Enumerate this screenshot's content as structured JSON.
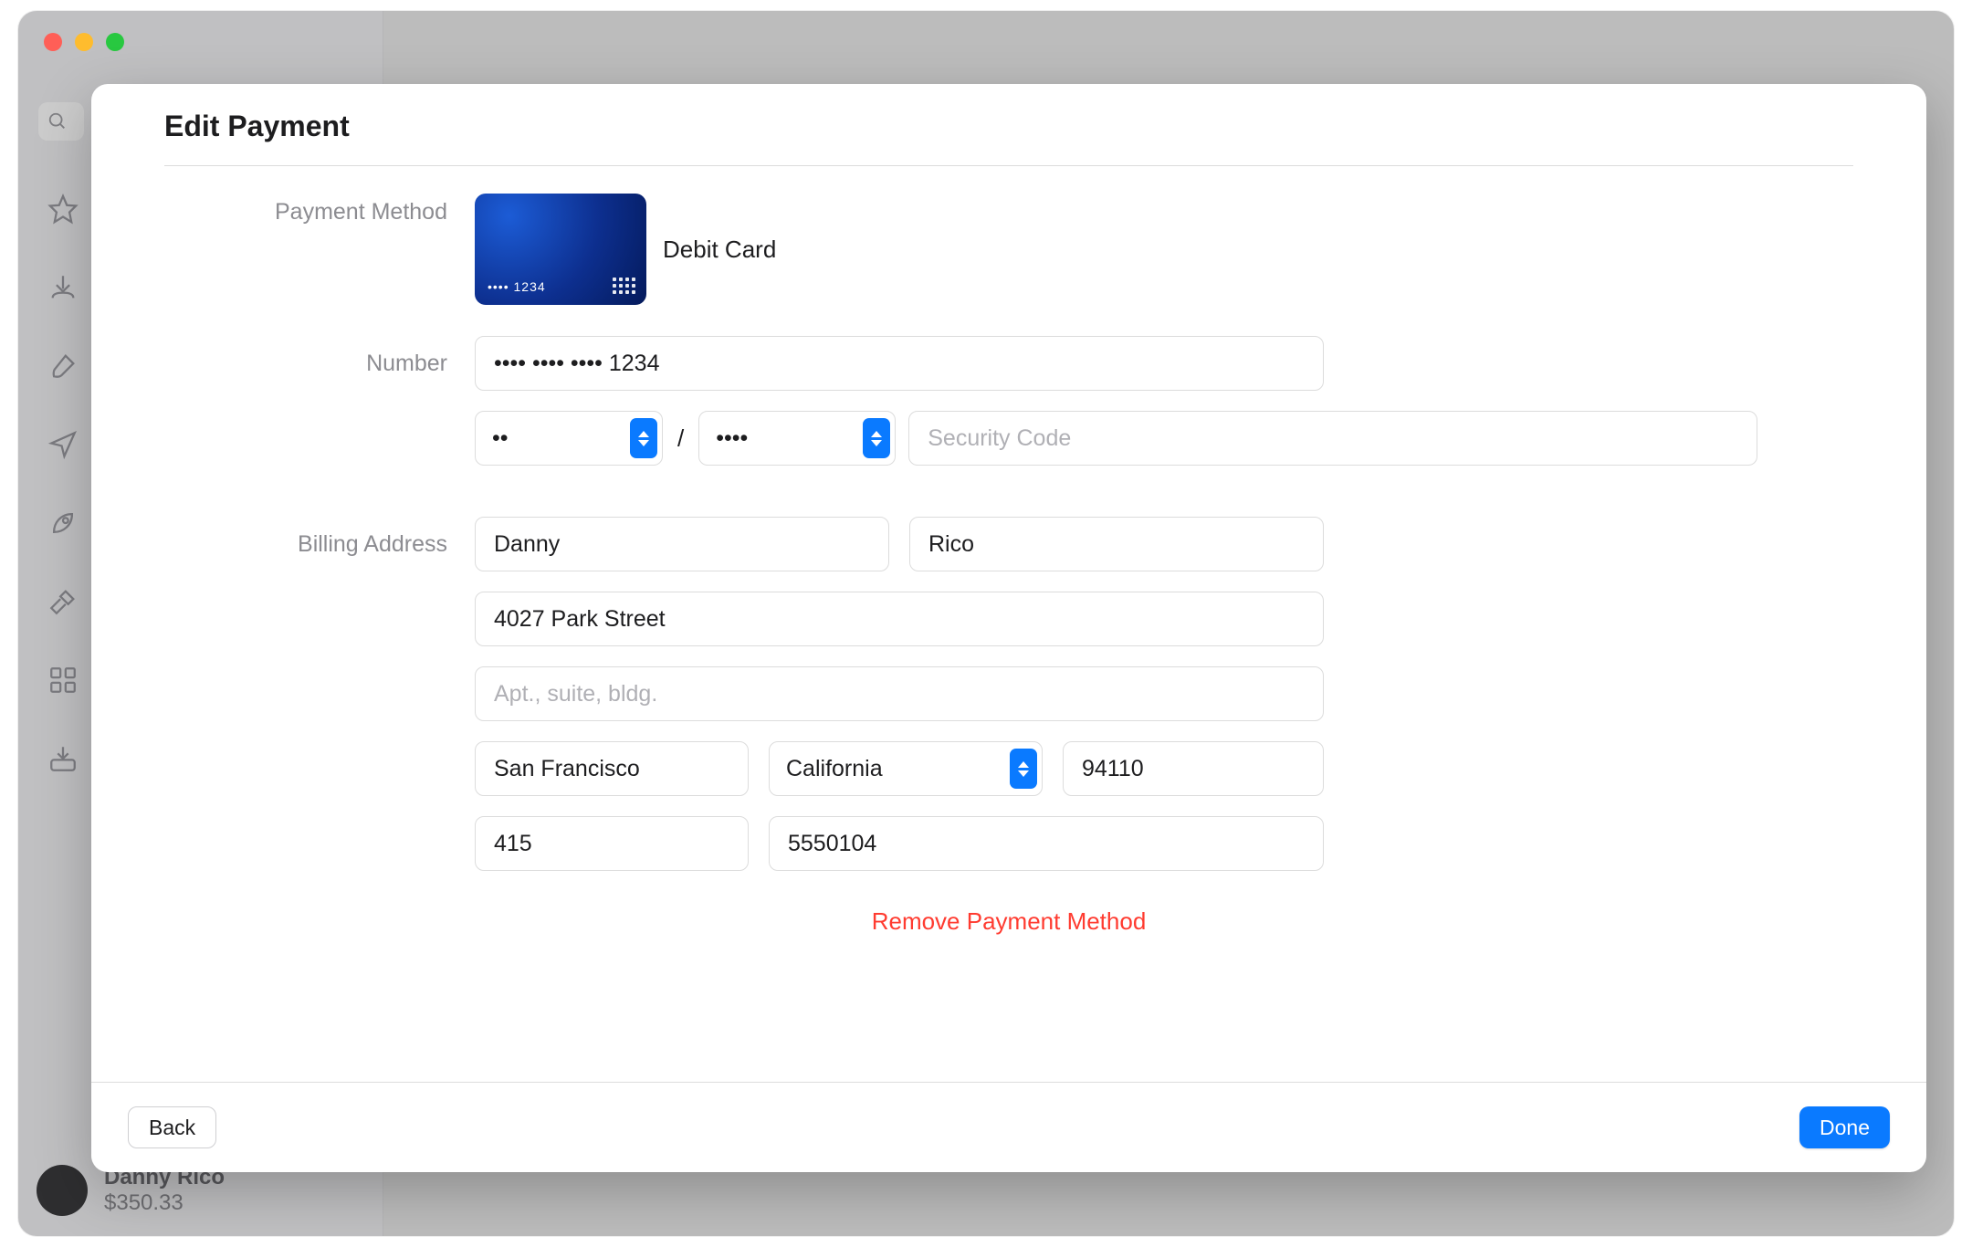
{
  "window": {
    "sidebar": {
      "footer_name": "Danny Rico",
      "footer_balance": "$350.33"
    }
  },
  "modal": {
    "title": "Edit Payment",
    "labels": {
      "payment_method": "Payment Method",
      "number": "Number",
      "billing_address": "Billing Address"
    },
    "card": {
      "type": "Debit Card",
      "art_last4": "•••• 1234",
      "number_value": "•••• •••• •••• 1234",
      "exp_month": "••",
      "exp_year": "••••",
      "security_placeholder": "Security Code"
    },
    "billing": {
      "first": "Danny",
      "last": "Rico",
      "street": "4027 Park Street",
      "street2_placeholder": "Apt., suite, bldg.",
      "street2_value": "",
      "city": "San Francisco",
      "state": "California",
      "zip": "94110",
      "phone_area": "415",
      "phone_number": "5550104"
    },
    "actions": {
      "remove": "Remove Payment Method",
      "back": "Back",
      "done": "Done"
    }
  }
}
